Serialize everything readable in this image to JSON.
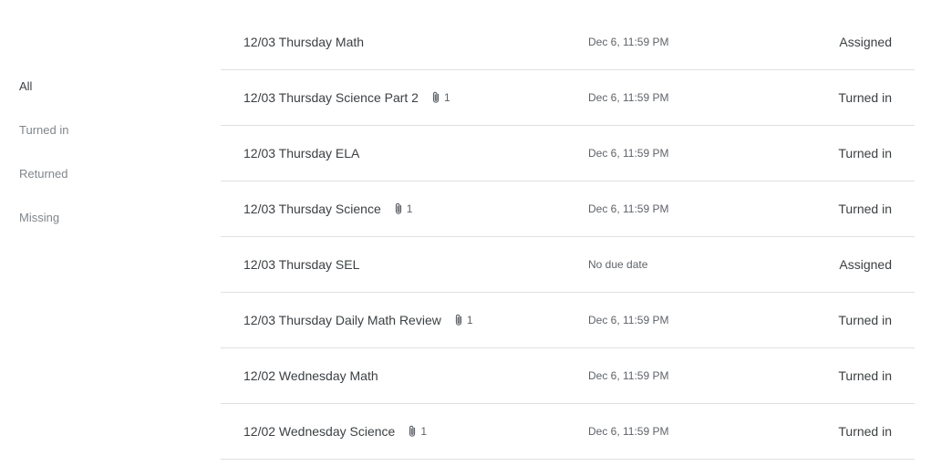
{
  "filters": [
    {
      "label": "All",
      "active": true
    },
    {
      "label": "Turned in",
      "active": false
    },
    {
      "label": "Returned",
      "active": false
    },
    {
      "label": "Missing",
      "active": false
    }
  ],
  "assignments": [
    {
      "title": "12/03 Thursday Math",
      "attachments": null,
      "due": "Dec 6, 11:59 PM",
      "status": "Assigned"
    },
    {
      "title": "12/03 Thursday Science Part 2",
      "attachments": "1",
      "due": "Dec 6, 11:59 PM",
      "status": "Turned in"
    },
    {
      "title": "12/03 Thursday ELA",
      "attachments": null,
      "due": "Dec 6, 11:59 PM",
      "status": "Turned in"
    },
    {
      "title": "12/03 Thursday Science",
      "attachments": "1",
      "due": "Dec 6, 11:59 PM",
      "status": "Turned in"
    },
    {
      "title": "12/03 Thursday SEL",
      "attachments": null,
      "due": "No due date",
      "status": "Assigned"
    },
    {
      "title": "12/03 Thursday Daily Math Review",
      "attachments": "1",
      "due": "Dec 6, 11:59 PM",
      "status": "Turned in"
    },
    {
      "title": "12/02 Wednesday Math",
      "attachments": null,
      "due": "Dec 6, 11:59 PM",
      "status": "Turned in"
    },
    {
      "title": "12/02 Wednesday Science",
      "attachments": "1",
      "due": "Dec 6, 11:59 PM",
      "status": "Turned in"
    }
  ],
  "icons": {
    "attachment": "paperclip-icon"
  }
}
